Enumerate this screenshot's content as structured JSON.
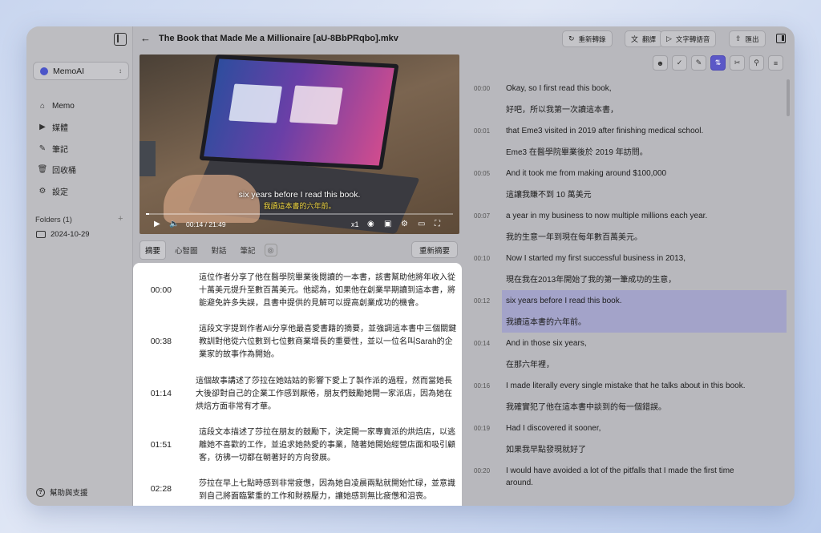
{
  "app": {
    "workspace": "MemoAI",
    "nav": [
      {
        "icon": "home-icon",
        "label": "Memo"
      },
      {
        "icon": "media-icon",
        "label": "媒體"
      },
      {
        "icon": "pen-icon",
        "label": "筆記"
      },
      {
        "icon": "trash-icon",
        "label": "回收桶"
      },
      {
        "icon": "gear-icon",
        "label": "設定"
      }
    ],
    "folders_title": "Folders (1)",
    "folder": "2024-10-29",
    "help": "幫助與支援"
  },
  "header": {
    "title": "The Book that Made Me a Millionaire [aU-8BbPRqbo].mkv",
    "buttons": {
      "retranscribe": "重新轉錄",
      "translate": "翻譯",
      "tts": "文字轉語音",
      "export": "匯出"
    }
  },
  "video": {
    "subtitle_en": "six years before I read this book.",
    "subtitle_zh": "我讀這本書的六年前。",
    "time": "00:14 / 21:49",
    "speed": "x1",
    "progress": 0.011
  },
  "summary": {
    "tabs": [
      "摘要",
      "心智圖",
      "對話",
      "筆記"
    ],
    "regen": "重新摘要",
    "items": [
      {
        "time": "00:00",
        "lines": [
          "這位作者分享了他在醫學院畢業後閱讀的一本書，該書幫助他將年收入從",
          "十萬美元提升至數百萬美元。他認為，如果他在創業早期讀到這本書，將",
          "能避免許多失誤，且書中提供的見解可以提高創業成功的機會。"
        ]
      },
      {
        "time": "00:38",
        "lines": [
          "這段文字提到作者Ali分享他最喜愛書籍的摘要，並強調這本書中三個關鍵",
          "教訓對他從六位數到七位數商業增長的重要性，並以一位名叫Sarah的企",
          "業家的故事作為開始。"
        ]
      },
      {
        "time": "01:14",
        "lines": [
          "這個故事講述了莎拉在她姑姑的影響下愛上了製作派的過程，然而當她長",
          "大後卻對自己的企業工作感到厭倦，朋友們鼓勵她開一家派店，因為她在",
          "烘焙方面非常有才華。"
        ]
      },
      {
        "time": "01:51",
        "lines": [
          "這段文本描述了莎拉在朋友的鼓勵下，決定開一家專賣派的烘焙店，以逃",
          "離她不喜歡的工作，並追求她熱愛的事業，隨著她開始經營店面和吸引顧",
          "客，彷彿一切都在朝著好的方向發展。"
        ]
      },
      {
        "time": "02:28",
        "lines": [
          "莎拉在早上七點時感到非常疲憊，因為她自凌晨兩點就開始忙碌，並意識",
          "到自己將面臨繁重的工作和財務壓力，讓她感到無比疲憊和沮喪。"
        ]
      }
    ]
  },
  "transcript": [
    {
      "time": "00:00",
      "en": "Okay, so I first read this book,",
      "zh": "好吧，所以我第一次讀這本書，"
    },
    {
      "time": "00:01",
      "en": "that Eme3 visited in 2019 after finishing medical school.",
      "zh": "Eme3 在醫學院畢業後於 2019 年訪問。"
    },
    {
      "time": "00:05",
      "en": "And it took me from making around $100,000",
      "zh": "這讓我賺不到 10 萬美元"
    },
    {
      "time": "00:07",
      "en": "a year in my business to now multiple millions each year.",
      "zh": "我的生意一年到現在每年數百萬美元。"
    },
    {
      "time": "00:10",
      "en": "Now I started my first successful business in 2013,",
      "zh": "現在我在2013年開始了我的第一筆成功的生意，"
    },
    {
      "time": "00:12",
      "en": "six years before I read this book.",
      "zh": "我讀這本書的六年前。"
    },
    {
      "time": "00:14",
      "en": "And in those six years,",
      "zh": "在那六年裡，"
    },
    {
      "time": "00:16",
      "en": "I made literally every single mistake that he talks about in this book.",
      "zh": "我確實犯了他在這本書中談到的每一個錯誤。"
    },
    {
      "time": "00:19",
      "en": "Had I discovered it sooner,",
      "zh": "如果我早點發現就好了"
    },
    {
      "time": "00:20",
      "en": "I would have avoided a lot of the pitfalls that I made the first time",
      "en2": "around.",
      "zh": ""
    }
  ],
  "colors": {
    "accent": "#5b58c7",
    "highlight": "#9c9ccd",
    "subtitle_zh": "#f0d640"
  }
}
